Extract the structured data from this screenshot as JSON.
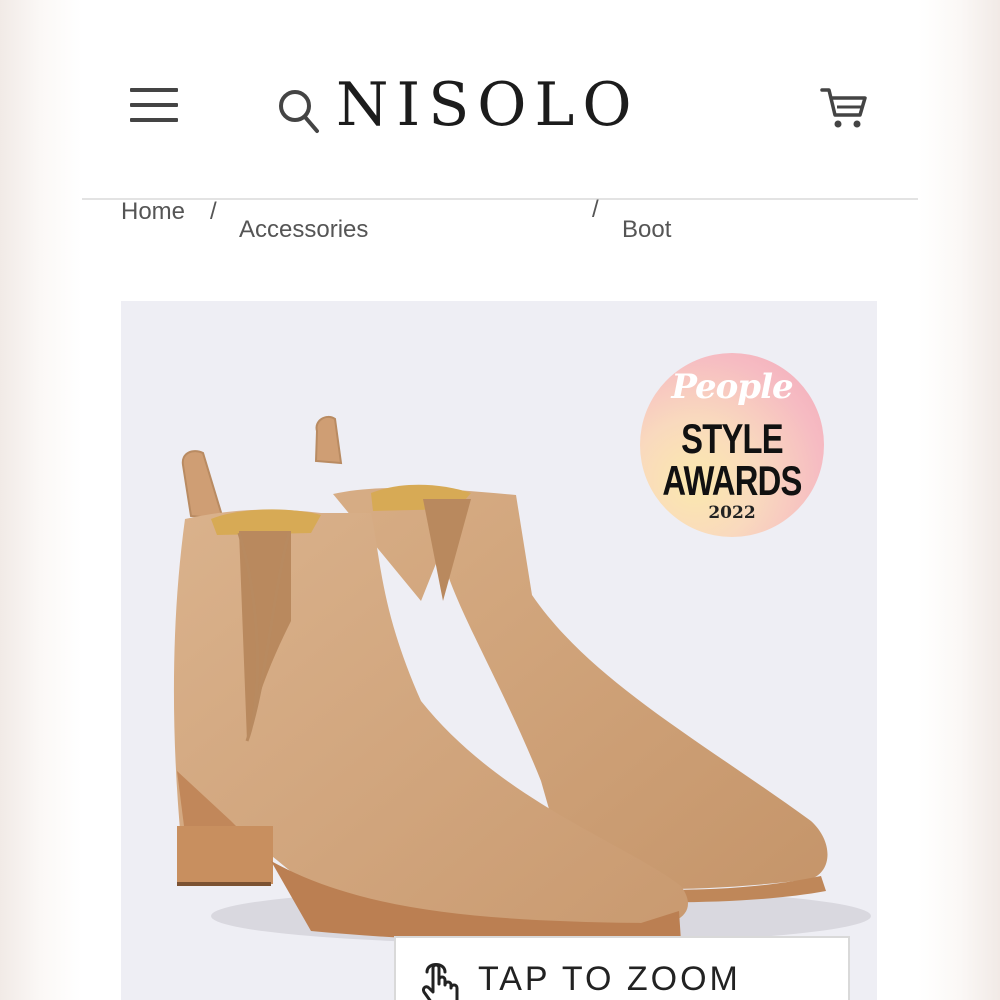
{
  "header": {
    "brand": "NISOLO",
    "icons": [
      "hamburger-menu-icon",
      "search-icon",
      "shopping-cart-icon"
    ]
  },
  "breadcrumb": {
    "home": "Home",
    "separator": "/",
    "category": "Accessories",
    "product": "Boot"
  },
  "product": {
    "badge": {
      "top": "People",
      "line1": "STYLE",
      "line2": "AWARDS",
      "year": "2022"
    },
    "zoom_label": "TAP TO ZOOM"
  },
  "colors": {
    "boot_leather": "#d3a77f",
    "boot_sole": "#bf8759",
    "image_background": "#eeeef4"
  }
}
